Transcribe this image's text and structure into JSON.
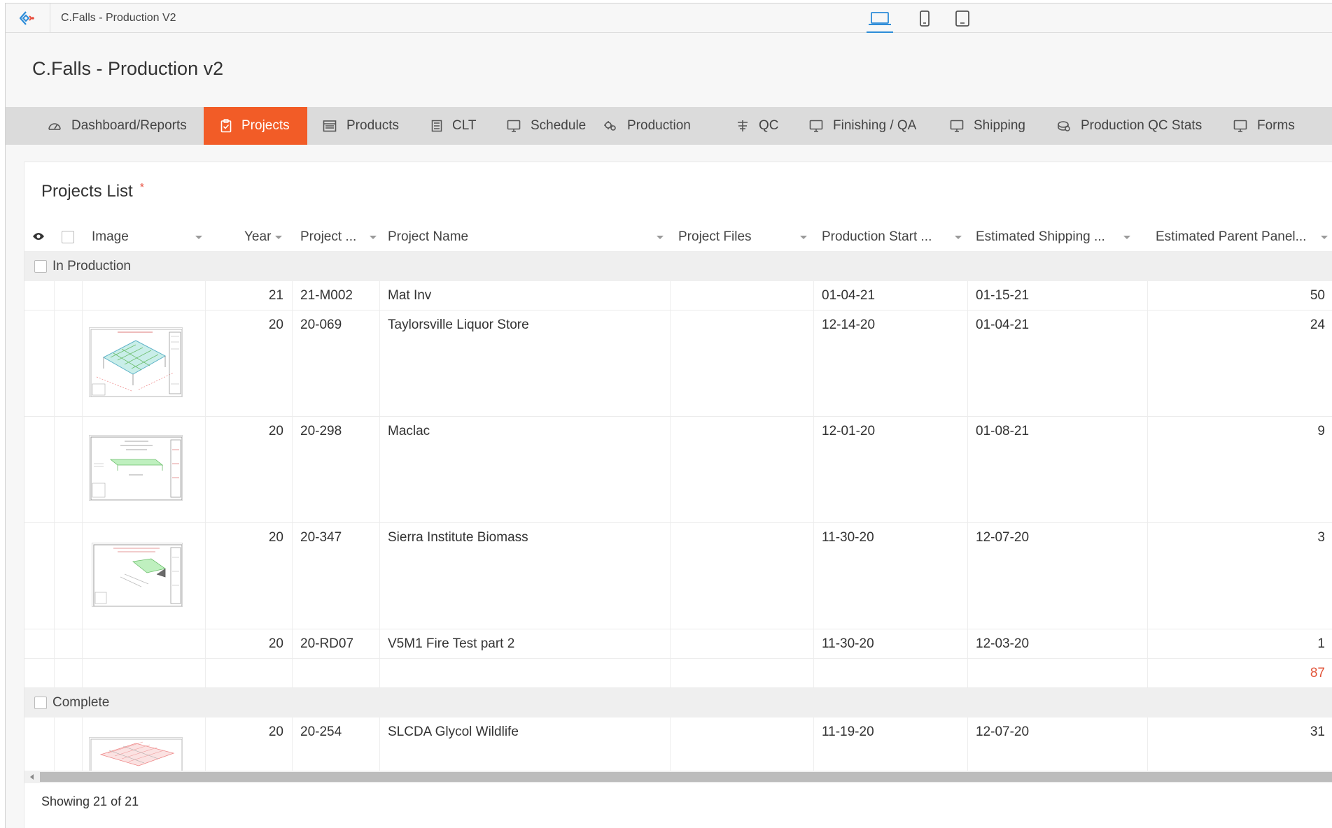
{
  "window": {
    "title": "C.Falls - Production V2"
  },
  "app": {
    "title": "C.Falls - Production v2"
  },
  "nav": {
    "items": [
      {
        "label": "Dashboard/Reports",
        "icon": "dashboard-icon"
      },
      {
        "label": "Projects",
        "icon": "clipboard-icon",
        "active": true
      },
      {
        "label": "Products",
        "icon": "calendar-icon"
      },
      {
        "label": "CLT",
        "icon": "list-icon"
      },
      {
        "label": "Schedule",
        "icon": "monitor-icon"
      },
      {
        "label": "Production",
        "icon": "gears-icon"
      },
      {
        "label": "QC",
        "icon": "checklist-icon"
      },
      {
        "label": "Finishing / QA",
        "icon": "monitor-icon"
      },
      {
        "label": "Shipping",
        "icon": "monitor-icon"
      },
      {
        "label": "Production QC Stats",
        "icon": "stats-icon"
      },
      {
        "label": "Forms",
        "icon": "monitor-icon"
      }
    ]
  },
  "panel": {
    "title": "Projects List",
    "required_mark": "*"
  },
  "columns": {
    "image": "Image",
    "year": "Year",
    "project": "Project ...",
    "project_name": "Project Name",
    "project_files": "Project Files",
    "production_start": "Production Start ...",
    "estimated_shipping": "Estimated Shipping ...",
    "estimated_parent_panel": "Estimated Parent Panel..."
  },
  "groups": {
    "in_production": {
      "label": "In Production",
      "rows": [
        {
          "year": "21",
          "project": "21-M002",
          "name": "Mat Inv",
          "start": "01-04-21",
          "ship": "01-15-21",
          "panels": "50"
        },
        {
          "year": "20",
          "project": "20-069",
          "name": "Taylorsville Liquor Store",
          "start": "12-14-20",
          "ship": "01-04-21",
          "panels": "24"
        },
        {
          "year": "20",
          "project": "20-298",
          "name": "Maclac",
          "start": "12-01-20",
          "ship": "01-08-21",
          "panels": "9"
        },
        {
          "year": "20",
          "project": "20-347",
          "name": "Sierra Institute Biomass",
          "start": "11-30-20",
          "ship": "12-07-20",
          "panels": "3"
        },
        {
          "year": "20",
          "project": "20-RD07",
          "name": "V5M1 Fire Test part 2",
          "start": "11-30-20",
          "ship": "12-03-20",
          "panels": "1"
        }
      ],
      "total": "87"
    },
    "complete": {
      "label": "Complete",
      "rows": [
        {
          "year": "20",
          "project": "20-254",
          "name": "SLCDA Glycol Wildlife",
          "start": "11-19-20",
          "ship": "12-07-20",
          "panels": "31"
        }
      ]
    }
  },
  "footer": {
    "status": "Showing 21 of 21"
  },
  "colors": {
    "accent": "#f25c27",
    "nav_bg": "#dbdbdb",
    "device_active": "#2d8cd8",
    "total": "#e2553a"
  }
}
